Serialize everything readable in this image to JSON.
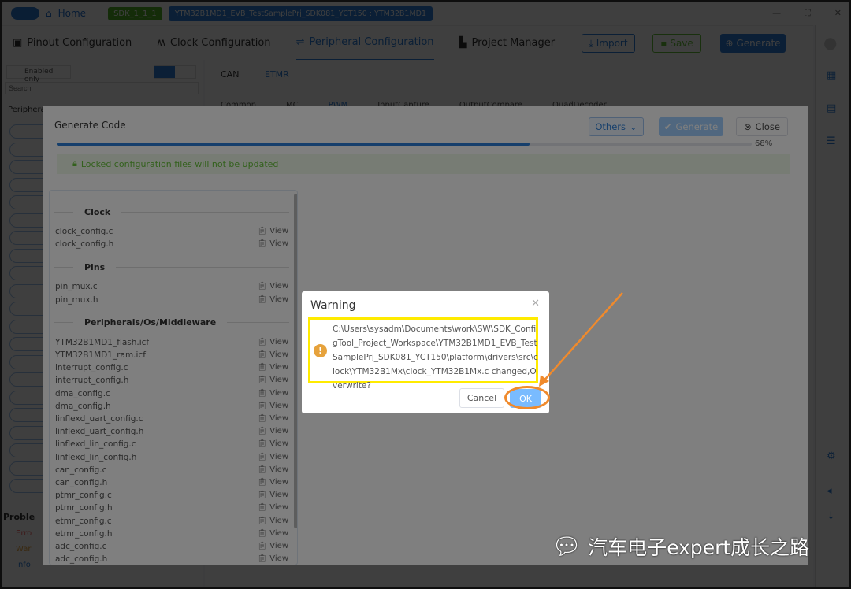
{
  "topbar": {
    "home": "Home",
    "sdk": "SDK_1_1_1",
    "project": "YTM32B1MD1_EVB_TestSamplePrj_SDK081_YCT150 : YTM32B1MD1"
  },
  "nav": {
    "tabs": [
      "Pinout Configuration",
      "Clock Configuration",
      "Peripheral Configuration",
      "Project Manager"
    ],
    "active": "Peripheral Configuration",
    "import": "Import",
    "save": "Save",
    "generate": "Generate"
  },
  "left": {
    "enabled_only": "Enabled only",
    "search_placeholder": "Search",
    "peripherals": "Periphera",
    "problems": "Proble",
    "errors": "Erro",
    "warnings": "War",
    "infos": "Info"
  },
  "main": {
    "tabs": [
      "CAN",
      "ETMR"
    ],
    "subtabs": [
      "Common",
      "MC",
      "PWM",
      "InputCapture",
      "OutputCompare",
      "QuadDecoder"
    ]
  },
  "generate_dialog": {
    "title": "Generate Code",
    "others": "Others",
    "generate": "Generate",
    "close": "Close",
    "progress_percent": 68,
    "progress_label": "68%",
    "lock_note": "Locked configuration files will not be updated",
    "view_label": "View",
    "sections": [
      {
        "title": "Clock",
        "files": [
          "clock_config.c",
          "clock_config.h"
        ]
      },
      {
        "title": "Pins",
        "files": [
          "pin_mux.c",
          "pin_mux.h"
        ]
      },
      {
        "title": "Peripherals/Os/Middleware",
        "files": [
          "YTM32B1MD1_flash.icf",
          "YTM32B1MD1_ram.icf",
          "interrupt_config.c",
          "interrupt_config.h",
          "dma_config.c",
          "dma_config.h",
          "linflexd_uart_config.c",
          "linflexd_uart_config.h",
          "linflexd_lin_config.c",
          "linflexd_lin_config.h",
          "can_config.c",
          "can_config.h",
          "ptmr_config.c",
          "ptmr_config.h",
          "etmr_config.c",
          "etmr_config.h",
          "adc_config.c",
          "adc_config.h"
        ]
      }
    ]
  },
  "warning_dialog": {
    "title": "Warning",
    "message": "C:\\Users\\sysadm\\Documents\\work\\SW\\SDK_ConfigTool_Project_Workspace\\YTM32B1MD1_EVB_TestSamplePrj_SDK081_YCT150\\platform\\drivers\\src\\clock\\YTM32B1Mx\\clock_YTM32B1Mx.c changed,Overwrite?",
    "cancel": "Cancel",
    "ok": "OK"
  },
  "watermark": "汽车电子expert成长之路",
  "colors": {
    "primary": "#2d7fd8",
    "highlight": "#ffeb00",
    "annotation": "#f08a2c",
    "warning": "#e6a23c"
  }
}
